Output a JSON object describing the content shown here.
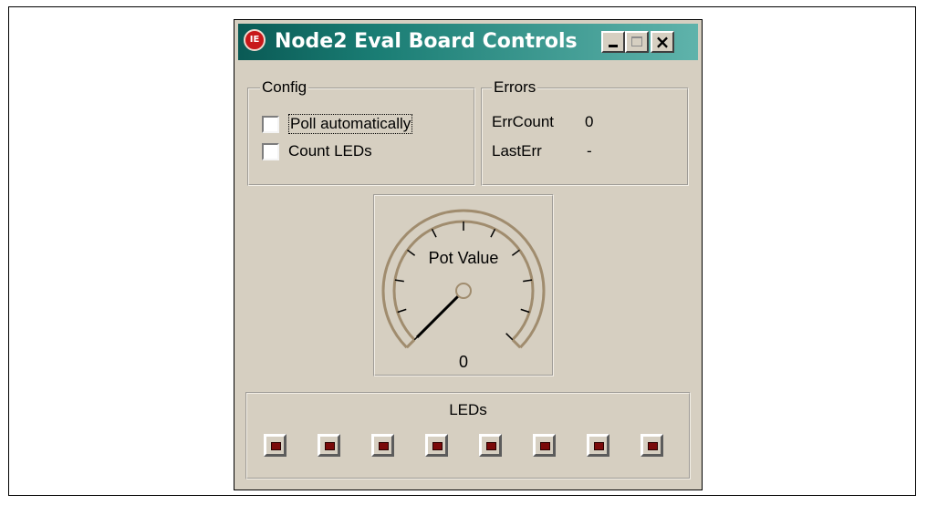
{
  "window": {
    "title": "Node2 Eval Board Controls",
    "icon": "app-logo-icon",
    "title_colors": [
      "#0a5a55",
      "#5fb3ab"
    ]
  },
  "titlebar_buttons": {
    "minimize": "minimize-icon",
    "maximize": "maximize-icon",
    "close": "close-icon",
    "close_glyph": "×"
  },
  "config": {
    "label": "Config",
    "options": [
      {
        "label": "Poll automatically",
        "checked": false
      },
      {
        "label": "Count LEDs",
        "checked": false
      }
    ]
  },
  "errors": {
    "label": "Errors",
    "rows": [
      {
        "label": "ErrCount",
        "value": "0"
      },
      {
        "label": "LastErr",
        "value": "-"
      }
    ]
  },
  "gauge": {
    "title": "Pot Value",
    "value": "0",
    "needle_fraction": 0,
    "colors": {
      "ring": "#a08c6e",
      "needle": "#000000"
    }
  },
  "leds": {
    "label": "LEDs",
    "states": [
      false,
      false,
      false,
      false,
      false,
      false,
      false,
      false
    ],
    "off_color": "#7a0a0a"
  }
}
